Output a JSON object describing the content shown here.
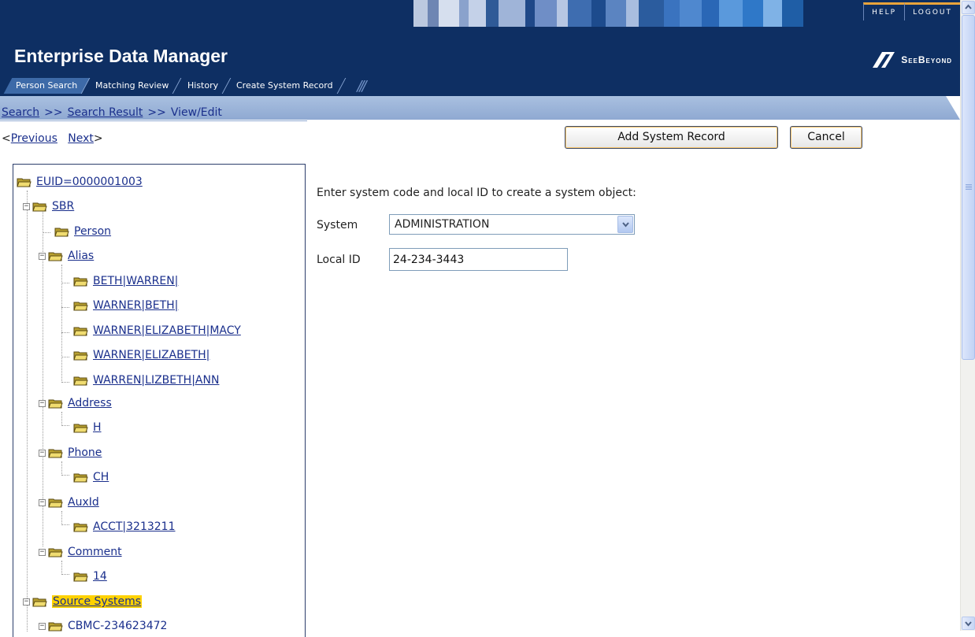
{
  "app": {
    "title": "Enterprise Data Manager",
    "brand": "SeeBeyond",
    "colors": {
      "header": "#0e2f63",
      "tab_active": "#3d6aa8",
      "crumb_bar": "#a9c0e0",
      "highlight": "#ffd200",
      "link": "#1a2f8c"
    }
  },
  "top_links": {
    "help": "HELP",
    "logout": "LOGOUT"
  },
  "tabs": [
    {
      "label": "Person Search",
      "active": true
    },
    {
      "label": "Matching Review",
      "active": false
    },
    {
      "label": "History",
      "active": false
    },
    {
      "label": "Create System Record",
      "active": false
    }
  ],
  "breadcrumb": {
    "search": "Search",
    "sep": ">>",
    "result": "Search Result",
    "current": "View/Edit"
  },
  "pager": {
    "lt": "<",
    "previous": "Previous",
    "next": "Next",
    "gt": ">"
  },
  "buttons": {
    "add_system_record": "Add System Record",
    "cancel": "Cancel"
  },
  "tree": {
    "root": "EUID=0000001003",
    "sbr": "SBR",
    "person": "Person",
    "alias": "Alias",
    "alias_items": [
      "BETH|WARREN|",
      "WARNER|BETH|",
      "WARNER|ELIZABETH|MACY",
      "WARNER|ELIZABETH|",
      "WARREN|LIZBETH|ANN"
    ],
    "address": "Address",
    "address_items": [
      "H"
    ],
    "phone": "Phone",
    "phone_items": [
      "CH"
    ],
    "auxid": "AuxId",
    "auxid_items": [
      "ACCT|3213211"
    ],
    "comment": "Comment",
    "comment_items": [
      "14"
    ],
    "source_systems": "Source Systems",
    "source_items": [
      "CBMC-234623472"
    ]
  },
  "form": {
    "instruction": "Enter system code and local ID to create a system object:",
    "system_label": "System",
    "system_value": "ADMINISTRATION",
    "localid_label": "Local ID",
    "localid_value": "24-234-3443"
  }
}
